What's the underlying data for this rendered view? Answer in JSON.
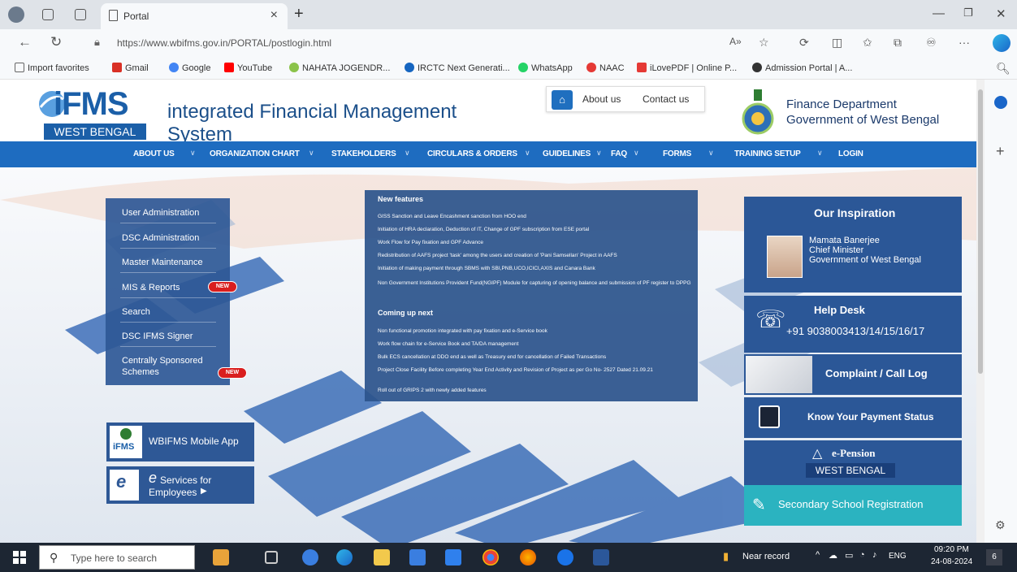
{
  "browser": {
    "tab_title": "Portal",
    "url": "https://www.wbifms.gov.in/PORTAL/postlogin.html",
    "favorites": [
      "Import favorites",
      "Gmail",
      "Google",
      "YouTube",
      "NAHATA JOGENDR...",
      "IRCTC Next Generati...",
      "WhatsApp",
      "NAAC",
      "iLovePDF | Online P...",
      "Admission Portal | A..."
    ]
  },
  "header": {
    "logo_ifms": "iFMS",
    "logo_full": "integrated Financial Management System",
    "logo_wb": "WEST BENGAL",
    "about_us": "About us",
    "contact_us": "Contact us",
    "dept_line1": "Finance Department",
    "dept_line2": "Government of West Bengal"
  },
  "nav": [
    "ABOUT US",
    "ORGANIZATION CHART",
    "STAKEHOLDERS",
    "CIRCULARS & ORDERS",
    "GUIDELINES",
    "FAQ",
    "FORMS",
    "TRAINING SETUP",
    "LOGIN"
  ],
  "sidemenu": {
    "items": [
      "User Administration",
      "DSC Administration",
      "Master Maintenance",
      "MIS & Reports",
      "Search",
      "DSC IFMS Signer",
      "Centrally Sponsored",
      "Schemes"
    ],
    "new_badge": "NEW"
  },
  "features": {
    "new_heading": "New features",
    "new_items": [
      "GISS Sanction and Leave Encashment sanction from HOO end",
      "Initiation of HRA declaration, Deduction of IT, Change of GPF subscription from ESE portal",
      "Work Flow for Pay fixation and GPF Advance",
      "Redistribution of AAFS project 'task' among the users and creation of 'Pani Samsellan' Project in AAFS",
      "Initiation of making payment through SBMS with SBI,PNB,UCO,ICICI,AXIS and Canara Bank",
      "Non Government Institutions Provident Fund(NGIPF) Module for capturing of opening balance and submission of PF register to DPPG"
    ],
    "coming_heading": "Coming up next",
    "coming_items": [
      "Non functional promotion integrated with pay fixation and e-Service book",
      "Work flow chain for e-Service Book and TA/DA management",
      "Bulk ECS cancellation at DDO end as well as Treasury end for cancellation of Failed Transactions",
      "Project Close Facility Before completing Year End Activity and Revision of Project as per Go No- 2527 Dated 21.09.21",
      "Roll out of GRIPS 2 with newly added features"
    ]
  },
  "apps": {
    "mobile_app": "WBIFMS Mobile App",
    "mobile_logo": "iFMS",
    "esvc_line1": "Services for",
    "esvc_line2": "Employees",
    "esvc_e": "e"
  },
  "right": {
    "inspiration_title": "Our Inspiration",
    "name": "Mamata Banerjee",
    "role": "Chief Minister",
    "gov": "Government of West Bengal",
    "help_title": "Help Desk",
    "help_phone": "+91 9038003413/14/15/16/17",
    "complaint": "Complaint / Call Log",
    "payment": "Know Your Payment Status",
    "epension": "e-Pension",
    "epension_wb": "WEST BENGAL",
    "secondary": "Secondary School Registration"
  },
  "taskbar": {
    "search_placeholder": "Type here to search",
    "near_record": "Near record",
    "lang": "ENG",
    "time": "09:20 PM",
    "date": "24-08-2024",
    "notif_count": "6"
  },
  "colors": {
    "nav_blue": "#1e6cc0",
    "panel_blue": "#2b5797",
    "accent_teal": "#2bb3c0",
    "new_red": "#d91e1e"
  }
}
